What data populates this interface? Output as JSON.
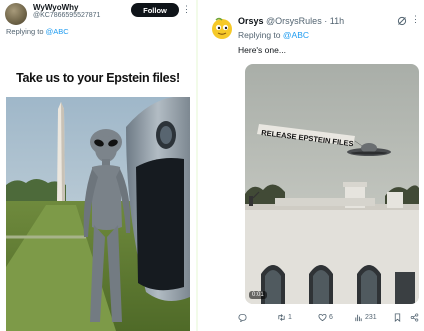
{
  "left_tweet": {
    "author_name": "WyWyoWhy",
    "author_handle": "@KC786659552787​1",
    "follow_label": "Follow",
    "more_glyph": "⋮",
    "replying_prefix": "Replying to",
    "replying_to": "@ABC",
    "meme_caption": "Take us to your Epstein files!"
  },
  "right_tweet": {
    "author_name": "Orsys",
    "author_handle": "@OrsysRules",
    "separator": "·",
    "time": "11h",
    "more_glyph": "⋮",
    "replying_prefix": "Replying to",
    "replying_to": "@ABC",
    "text": "Here's one...",
    "image_banner": "RELEASE EPSTEIN FILES",
    "video_time": "0:01",
    "actions": {
      "replies": "",
      "retweets": "1",
      "likes": "6",
      "views": "231"
    }
  },
  "colors": {
    "link": "#1d9bf0",
    "text_primary": "#0f1419",
    "text_secondary": "#536471",
    "page_background": "#f2fbe9"
  }
}
